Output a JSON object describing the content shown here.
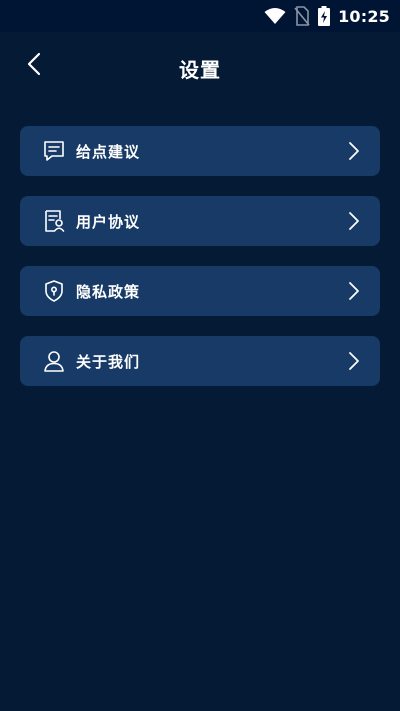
{
  "status_bar": {
    "time": "10:25",
    "icons": [
      "wifi-icon",
      "no-sim-icon",
      "battery-charging-icon"
    ]
  },
  "header": {
    "title": "设置",
    "back_icon": "chevron-left-icon"
  },
  "menu": {
    "items": [
      {
        "label": "给点建议",
        "icon": "feedback-chat-icon",
        "chevron": "chevron-right-icon"
      },
      {
        "label": "用户协议",
        "icon": "user-agreement-icon",
        "chevron": "chevron-right-icon"
      },
      {
        "label": "隐私政策",
        "icon": "privacy-shield-icon",
        "chevron": "chevron-right-icon"
      },
      {
        "label": "关于我们",
        "icon": "user-profile-icon",
        "chevron": "chevron-right-icon"
      }
    ]
  },
  "colors": {
    "background": "#051a35",
    "status_bar": "#001433",
    "card": "#173a67",
    "text": "#ffffff"
  }
}
